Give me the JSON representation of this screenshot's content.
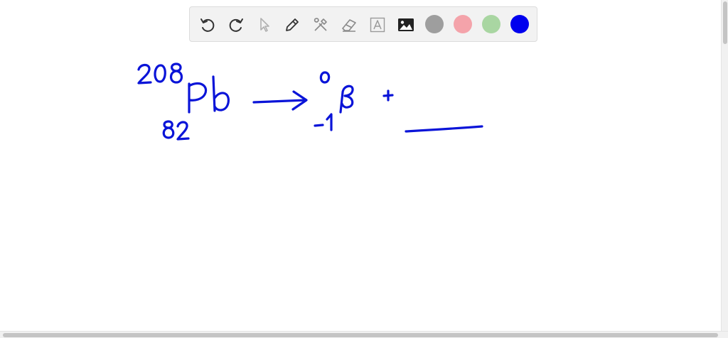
{
  "toolbar": {
    "tools": [
      {
        "name": "undo-icon"
      },
      {
        "name": "redo-icon"
      },
      {
        "name": "select-cursor-icon"
      },
      {
        "name": "pen-icon"
      },
      {
        "name": "tools-icon"
      },
      {
        "name": "eraser-icon"
      },
      {
        "name": "text-box-icon"
      },
      {
        "name": "image-icon"
      }
    ],
    "colors": [
      "#9e9e9e",
      "#f4a3aa",
      "#a9d6a2",
      "#0000ee"
    ],
    "selected_color": "#0000ee"
  },
  "whiteboard": {
    "ink_color": "#0a14d8",
    "equation": {
      "reactant_mass_number": "208",
      "reactant_atomic_number": "82",
      "reactant_symbol": "Pb",
      "arrow": "→",
      "product1_mass_number": "0",
      "product1_charge_number": "-1",
      "product1_symbol": "β",
      "plus": "+",
      "blank": "____"
    }
  }
}
